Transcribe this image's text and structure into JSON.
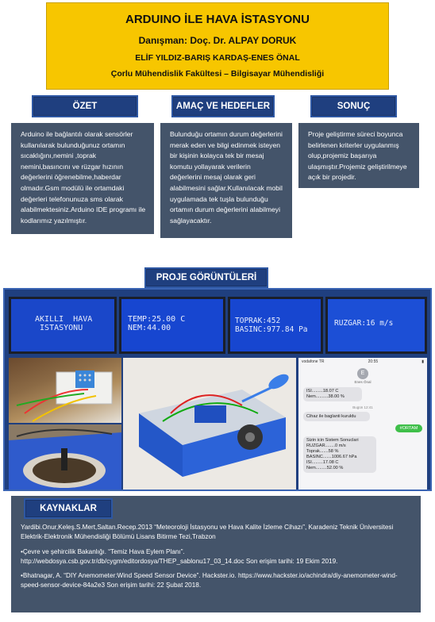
{
  "header": {
    "title": "ARDUINO İLE HAVA İSTASYONU",
    "advisor": "Danışman: Doç. Dr. ALPAY DORUK",
    "authors": "ELİF YILDIZ-BARIŞ KARDAŞ-ENES ÖNAL",
    "faculty": "Çorlu Mühendislik Fakültesi – Bilgisayar Mühendisliği"
  },
  "sections": {
    "ozet_label": "ÖZET",
    "amac_label": "AMAÇ VE HEDEFLER",
    "sonuc_label": "SONUÇ",
    "proje_label": "PROJE GÖRÜNTÜLERİ",
    "kaynak_label": "KAYNAKLAR"
  },
  "ozet_text": "Arduino ile bağlantılı olarak sensörler kullanılarak bulunduğunuz ortamın sıcaklığını,nemini ,toprak nemini,basıncını ve rüzgar hızının değerlerini öğrenebilme,haberdar olmadır.Gsm modülü ile ortamdaki değerleri telefonunuza sms olarak alabilmektesiniz.Arduino IDE programı ile kodlarımız yazılmıştır.",
  "amac_text": "Bulunduğu ortamın durum değerlerini merak eden ve bilgi edinmek isteyen bir kişinin kolayca tek bir mesaj komutu yollayarak verilerin değerlerini mesaj olarak geri alabilmesini sağlar.Kullanılacak mobil uygulamada tek tuşla bulunduğu ortamın durum değerlerini alabilmeyi sağlayacaktır.",
  "sonuc_text": "Proje geliştirme süreci boyunca belirlenen kriterler uygulanmış olup,projemiz başarıya ulaşmıştır.Projemiz geliştirilmeye açık bir projedir.",
  "lcd_screens": [
    {
      "line1": " AKILLI  HAVA",
      "line2": "  ISTASYONU"
    },
    {
      "line1": "TEMP:25.00 C",
      "line2": "NEM:44.00"
    },
    {
      "line1": "TOPRAK:452",
      "line2": "BASINC:977.84 Pa"
    },
    {
      "line1": "RUZGAR:16 m/s",
      "line2": ""
    }
  ],
  "phone": {
    "carrier": "vodafone TR",
    "time": "20:55",
    "contact_initial": "E",
    "contact_name": "Enes Önal",
    "msg1_lines": [
      "ISI.........18.07 C",
      "Nem..........38.00 %"
    ],
    "msg2_stamp": "Bugün 12:41",
    "msg2": "Cihaz ile baglanti kuruldu",
    "sent_msg": "#ORTAM",
    "msg3_lines": [
      "Sizin icin Sistem Sonuclari",
      "RUZGAR........0 m/s",
      "Toprak.......58 %",
      "BASINC.......1006.67 hPa",
      "ISI.........17.08 C",
      "Nem.........52.00 %"
    ]
  },
  "references": [
    "Yardibi.Onur,Keleş.S.Mert,Saltan.Recep.2013 “Meteoroloji İstasyonu ve Hava Kalite İzleme Cihazı”, Karadeniz Teknik Üniversitesi Elektrik-Elektronik Mühendisliği Bölümü Lisans Bitirme Tezi,Trabzon",
    "•Çevre ve şehircilik Bakanlığı. “Temiz Hava Eylem Planı”. http://webdosya.csb.gov.tr/db/cygm/editordosya/THEP_sablonu17_03_14.doc Son erişim tarihi: 19 Ekim 2019.",
    "•Bhatnagar, A. “DIY Anemometer:Wind Speed Sensor Device”. Hackster.io. https://www.hackster.io/achindra/diy-anemometer-wind-speed-sensor-device-84a2e3 Son erişim tarihi: 22 Şubat 2018."
  ],
  "colors": {
    "title_bg": "#f7c600",
    "header_bg": "#1f3f7f",
    "panel_bg": "#44546a",
    "lcd_bg": "#1746d0"
  }
}
